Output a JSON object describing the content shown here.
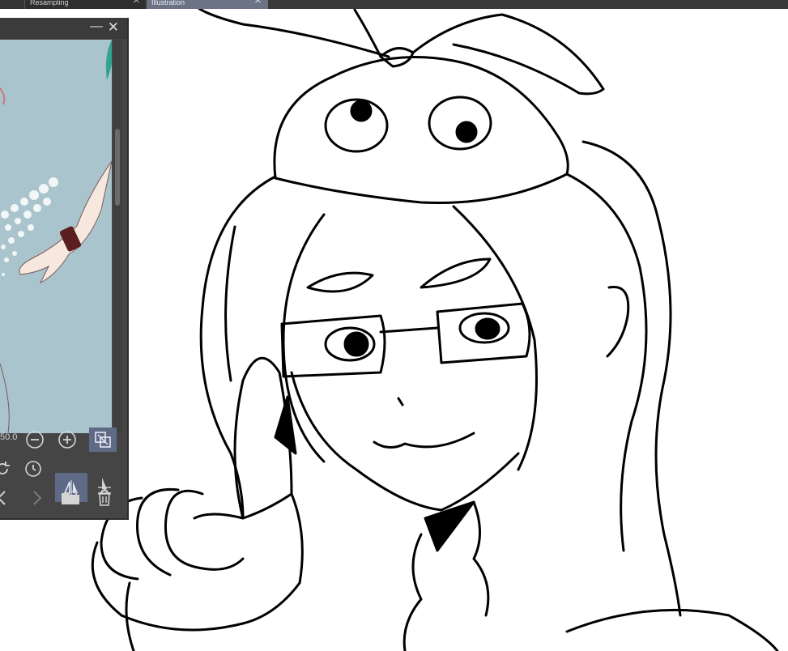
{
  "tabs": [
    {
      "label": "",
      "active": false
    },
    {
      "label": "Resampling",
      "active": false
    },
    {
      "label": "Illustration",
      "active": true
    }
  ],
  "navigator": {
    "zoom_value": "50.0",
    "buttons": [
      {
        "name": "zoom-out",
        "icon": "minus-circle-icon"
      },
      {
        "name": "zoom-in",
        "icon": "plus-circle-icon"
      },
      {
        "name": "fit-to-window",
        "icon": "fit-window-icon",
        "active": true
      },
      {
        "name": "rotate",
        "icon": "rotate-icon"
      },
      {
        "name": "reset-rotation",
        "icon": "reset-rotation-icon"
      },
      {
        "name": "flip-horizontal",
        "icon": "flip-horizontal-icon",
        "active": true
      },
      {
        "name": "flip-vertical",
        "icon": "flip-vertical-icon"
      },
      {
        "name": "back",
        "icon": "chevron-left-icon"
      },
      {
        "name": "forward",
        "icon": "chevron-right-icon"
      },
      {
        "name": "open-folder",
        "icon": "folder-icon"
      },
      {
        "name": "delete",
        "icon": "trash-icon"
      }
    ]
  },
  "colors": {
    "accent": "#5f6a86",
    "panel": "#454545",
    "tabbar": "#3a3a3a"
  }
}
